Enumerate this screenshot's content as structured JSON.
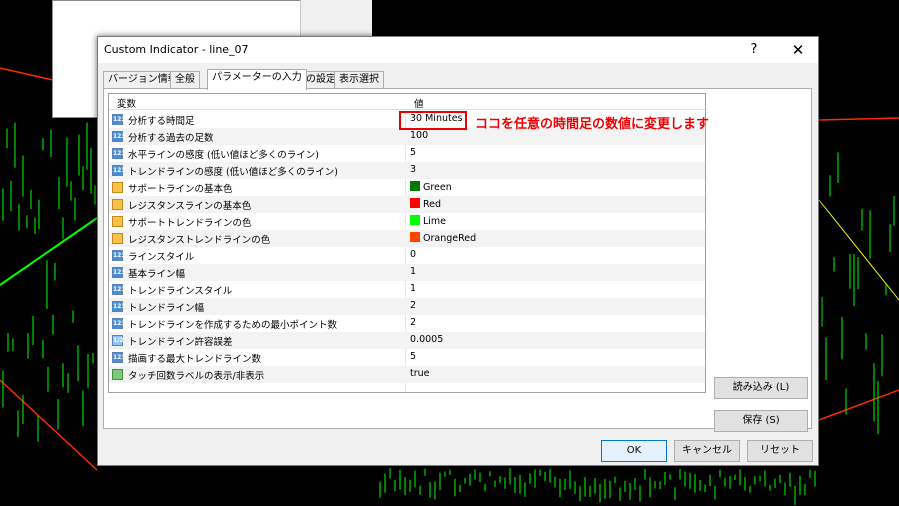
{
  "dialog": {
    "title": "Custom Indicator - line_07",
    "help_symbol": "?",
    "close_symbol": "✕"
  },
  "tabs": [
    "バージョン情報",
    "全般",
    "パラメーターの入力",
    "色の設定",
    "表示選択"
  ],
  "active_tab_index": 2,
  "grid": {
    "header_variable": "変数",
    "header_value": "値",
    "rows": [
      {
        "label": "分析する時間足",
        "value": "30 Minutes",
        "type": "int"
      },
      {
        "label": "分析する過去の足数",
        "value": "100",
        "type": "int"
      },
      {
        "label": "水平ラインの感度 (低い値ほど多くのライン)",
        "value": "5",
        "type": "int"
      },
      {
        "label": "トレンドラインの感度 (低い値ほど多くのライン)",
        "value": "3",
        "type": "int"
      },
      {
        "label": "サポートラインの基本色",
        "value": "Green",
        "type": "color",
        "swatch": "#007a00"
      },
      {
        "label": "レジスタンスラインの基本色",
        "value": "Red",
        "type": "color",
        "swatch": "#ff0000"
      },
      {
        "label": "サポートトレンドラインの色",
        "value": "Lime",
        "type": "color",
        "swatch": "#00ff00"
      },
      {
        "label": "レジスタンストレンドラインの色",
        "value": "OrangeRed",
        "type": "color",
        "swatch": "#ff4500"
      },
      {
        "label": "ラインスタイル",
        "value": "0",
        "type": "int"
      },
      {
        "label": "基本ライン幅",
        "value": "1",
        "type": "int"
      },
      {
        "label": "トレンドラインスタイル",
        "value": "1",
        "type": "int"
      },
      {
        "label": "トレンドライン幅",
        "value": "2",
        "type": "int"
      },
      {
        "label": "トレンドラインを作成するための最小ポイント数",
        "value": "2",
        "type": "int"
      },
      {
        "label": "トレンドライン許容誤差",
        "value": "0.0005",
        "type": "double"
      },
      {
        "label": "描画する最大トレンドライン数",
        "value": "5",
        "type": "int"
      },
      {
        "label": "タッチ回数ラベルの表示/非表示",
        "value": "true",
        "type": "bool"
      }
    ]
  },
  "annotation": "ココを任意の時間足の数値に変更します",
  "buttons": {
    "load": "読み込み (L)",
    "save": "保存 (S)",
    "ok": "OK",
    "cancel": "キャンセル",
    "reset": "リセット"
  },
  "colors": {
    "annotation": "#e00000",
    "chart_background": "#000000",
    "candle_color": "#00ff00",
    "red_line": "#ff2a00"
  }
}
